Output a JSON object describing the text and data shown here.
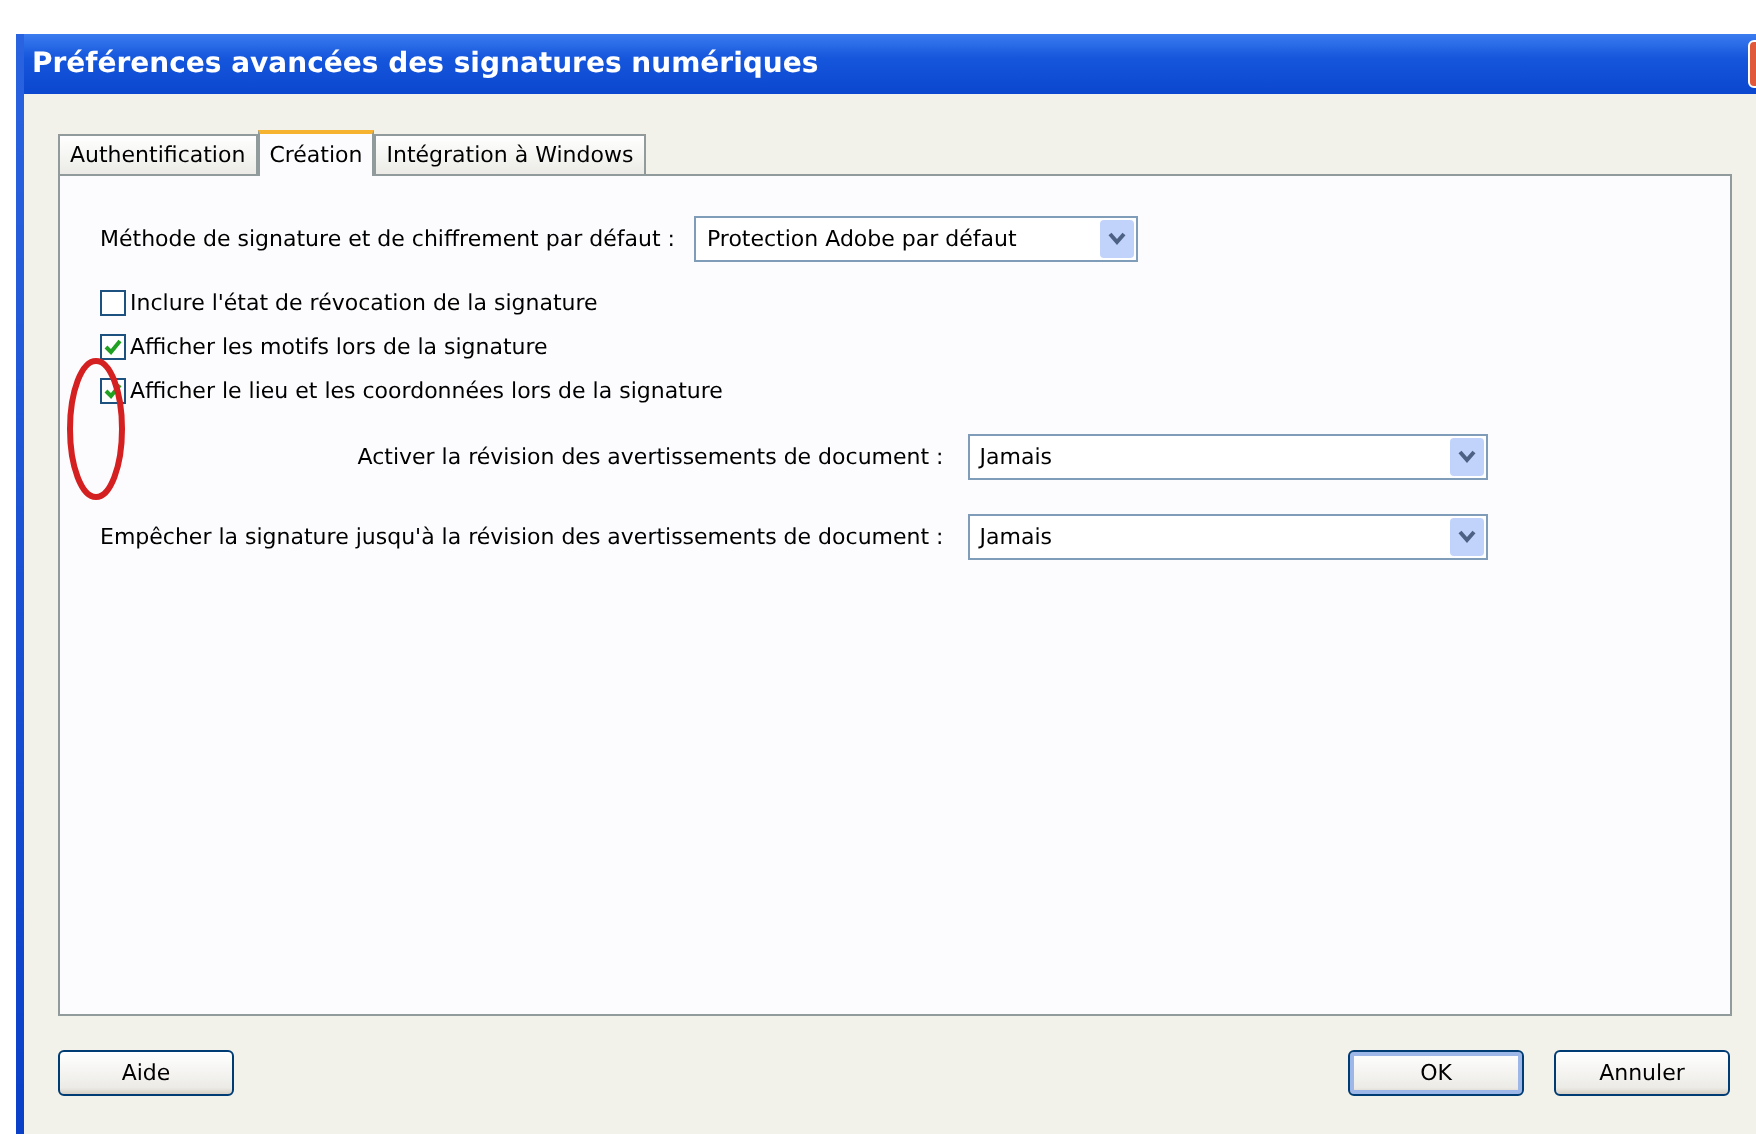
{
  "window": {
    "title": "Préférences avancées des signatures numériques"
  },
  "tabs": [
    {
      "label": "Authentification",
      "selected": false
    },
    {
      "label": "Création",
      "selected": true
    },
    {
      "label": "Intégration à Windows",
      "selected": false
    }
  ],
  "method": {
    "label": "Méthode de signature et de chiffrement par défaut :",
    "value": "Protection Adobe par défaut"
  },
  "checkboxes": [
    {
      "label": "Inclure l'état de révocation de la signature",
      "checked": false
    },
    {
      "label": "Afficher les motifs lors de la signature",
      "checked": true
    },
    {
      "label": "Afficher le lieu et les coordonnées lors de la signature",
      "checked": true
    }
  ],
  "dropdowns": [
    {
      "label": "Activer la révision des avertissements de document :",
      "value": "Jamais"
    },
    {
      "label": "Empêcher la signature jusqu'à la révision des avertissements de document :",
      "value": "Jamais"
    }
  ],
  "buttons_left": [
    {
      "label": "Aide",
      "default": false
    }
  ],
  "buttons_right": [
    {
      "label": "OK",
      "default": true
    },
    {
      "label": "Annuler",
      "default": false
    }
  ]
}
